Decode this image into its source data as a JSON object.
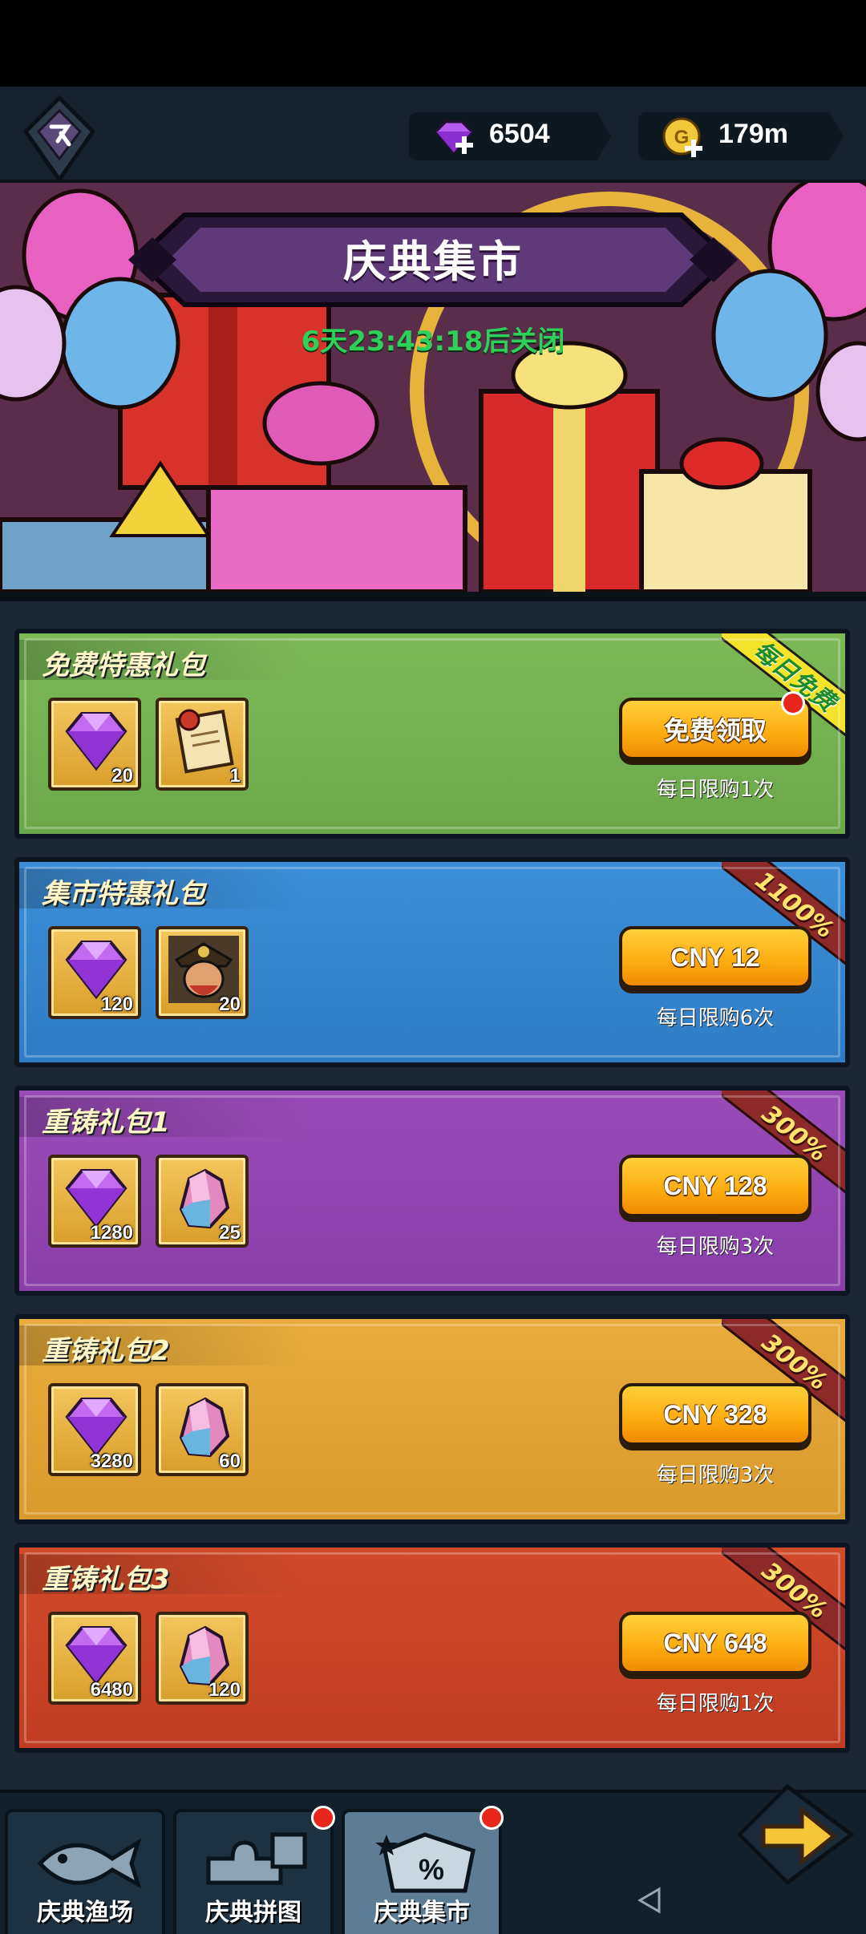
{
  "header": {
    "gems": "6504",
    "gold": "179m"
  },
  "banner": {
    "title": "庆典集市",
    "countdown": "6天23:43:18后关闭"
  },
  "packs": [
    {
      "title": "免费特惠礼包",
      "items": [
        {
          "icon": "gem-icon",
          "qty": "20"
        },
        {
          "icon": "scroll-icon",
          "qty": "1"
        }
      ],
      "button": "免费领取",
      "limit": "每日限购1次",
      "ribbon": "每日免费"
    },
    {
      "title": "集市特惠礼包",
      "items": [
        {
          "icon": "gem-icon",
          "qty": "120"
        },
        {
          "icon": "hero-portrait-icon",
          "qty": "20"
        }
      ],
      "button": "CNY 12",
      "limit": "每日限购6次",
      "ribbon": "1100%"
    },
    {
      "title": "重铸礼包1",
      "items": [
        {
          "icon": "gem-icon",
          "qty": "1280"
        },
        {
          "icon": "crystal-icon",
          "qty": "25"
        }
      ],
      "button": "CNY 128",
      "limit": "每日限购3次",
      "ribbon": "300%"
    },
    {
      "title": "重铸礼包2",
      "items": [
        {
          "icon": "gem-icon",
          "qty": "3280"
        },
        {
          "icon": "crystal-icon",
          "qty": "60"
        }
      ],
      "button": "CNY 328",
      "limit": "每日限购3次",
      "ribbon": "300%"
    },
    {
      "title": "重铸礼包3",
      "items": [
        {
          "icon": "gem-icon",
          "qty": "6480"
        },
        {
          "icon": "crystal-icon",
          "qty": "120"
        }
      ],
      "button": "CNY 648",
      "limit": "每日限购1次",
      "ribbon": "300%"
    }
  ],
  "nav": {
    "tabs": [
      {
        "label": "庆典渔场"
      },
      {
        "label": "庆典拼图"
      },
      {
        "label": "庆典集市"
      }
    ]
  },
  "colors": {
    "countdown": "#2fd05a",
    "button": "#ffae12",
    "green_pack": "#6aa84a",
    "blue_pack": "#2f7cc4",
    "purple_pack": "#8a3ea8",
    "gold_pack": "#d99a2c",
    "red_pack": "#c03c22"
  }
}
